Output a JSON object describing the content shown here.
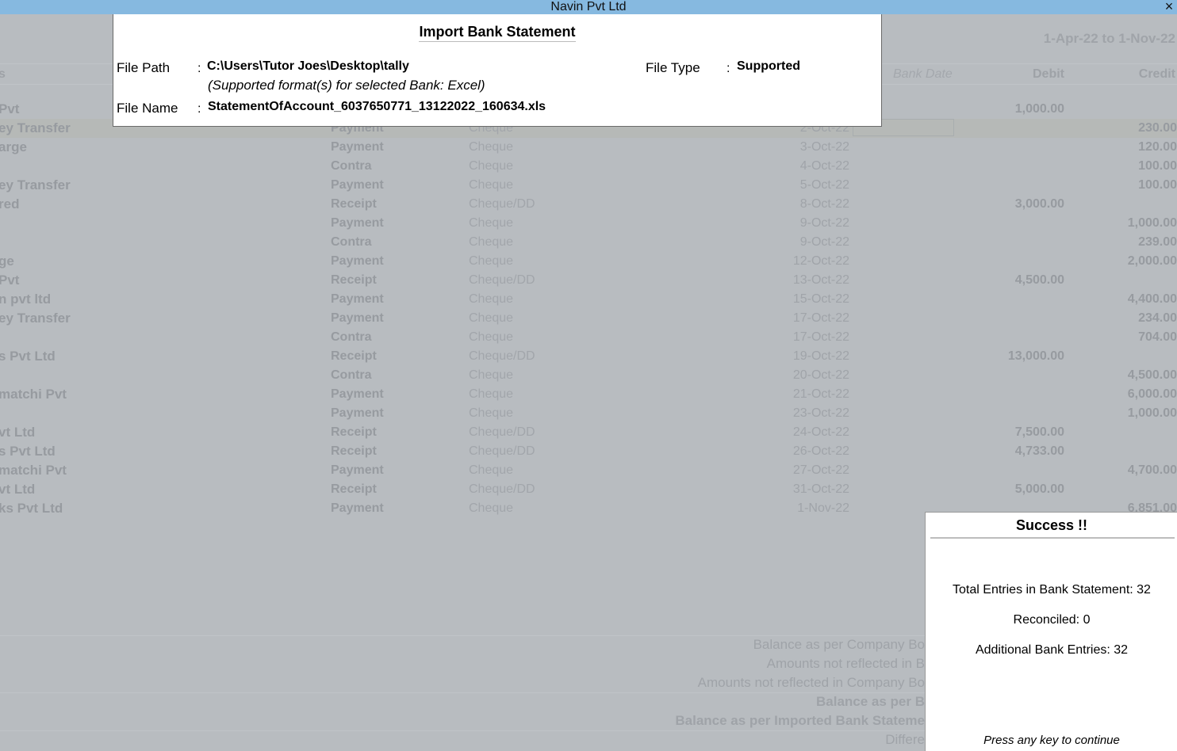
{
  "window": {
    "title": "Navin Pvt Ltd",
    "close_icon": "×"
  },
  "background": {
    "period": "1-Apr-22 to 1-Nov-22",
    "columns": {
      "particulars": "s",
      "bank_date": "Bank Date",
      "debit": "Debit",
      "credit": "Credit"
    },
    "rows": [
      {
        "particulars": "Pvt",
        "vch_type": "",
        "instrument": "",
        "date": "",
        "debit": "1,000.00",
        "credit": ""
      },
      {
        "particulars": "ey Transfer",
        "vch_type": "Payment",
        "instrument": "Cheque",
        "date": "2-Oct-22",
        "debit": "",
        "credit": "230.00"
      },
      {
        "particulars": "arge",
        "vch_type": "Payment",
        "instrument": "Cheque",
        "date": "3-Oct-22",
        "debit": "",
        "credit": "120.00"
      },
      {
        "particulars": "",
        "vch_type": "Contra",
        "instrument": "Cheque",
        "date": "4-Oct-22",
        "debit": "",
        "credit": "100.00"
      },
      {
        "particulars": "ey Transfer",
        "vch_type": "Payment",
        "instrument": "Cheque",
        "date": "5-Oct-22",
        "debit": "",
        "credit": "100.00"
      },
      {
        "particulars": "red",
        "vch_type": "Receipt",
        "instrument": "Cheque/DD",
        "date": "8-Oct-22",
        "debit": "3,000.00",
        "credit": ""
      },
      {
        "particulars": "",
        "vch_type": "Payment",
        "instrument": "Cheque",
        "date": "9-Oct-22",
        "debit": "",
        "credit": "1,000.00"
      },
      {
        "particulars": "",
        "vch_type": "Contra",
        "instrument": "Cheque",
        "date": "9-Oct-22",
        "debit": "",
        "credit": "239.00"
      },
      {
        "particulars": "ge",
        "vch_type": "Payment",
        "instrument": "Cheque",
        "date": "12-Oct-22",
        "debit": "",
        "credit": "2,000.00"
      },
      {
        "particulars": "Pvt",
        "vch_type": "Receipt",
        "instrument": "Cheque/DD",
        "date": "13-Oct-22",
        "debit": "4,500.00",
        "credit": ""
      },
      {
        "particulars": "n pvt ltd",
        "vch_type": "Payment",
        "instrument": "Cheque",
        "date": "15-Oct-22",
        "debit": "",
        "credit": "4,400.00"
      },
      {
        "particulars": "ey Transfer",
        "vch_type": "Payment",
        "instrument": "Cheque",
        "date": "17-Oct-22",
        "debit": "",
        "credit": "234.00"
      },
      {
        "particulars": "",
        "vch_type": "Contra",
        "instrument": "Cheque",
        "date": "17-Oct-22",
        "debit": "",
        "credit": "704.00"
      },
      {
        "particulars": "s Pvt Ltd",
        "vch_type": "Receipt",
        "instrument": "Cheque/DD",
        "date": "19-Oct-22",
        "debit": "13,000.00",
        "credit": ""
      },
      {
        "particulars": "",
        "vch_type": "Contra",
        "instrument": "Cheque",
        "date": "20-Oct-22",
        "debit": "",
        "credit": "4,500.00"
      },
      {
        "particulars": "matchi Pvt",
        "vch_type": "Payment",
        "instrument": "Cheque",
        "date": "21-Oct-22",
        "debit": "",
        "credit": "6,000.00"
      },
      {
        "particulars": "",
        "vch_type": "Payment",
        "instrument": "Cheque",
        "date": "23-Oct-22",
        "debit": "",
        "credit": "1,000.00"
      },
      {
        "particulars": "vt Ltd",
        "vch_type": "Receipt",
        "instrument": "Cheque/DD",
        "date": "24-Oct-22",
        "debit": "7,500.00",
        "credit": ""
      },
      {
        "particulars": "s Pvt Ltd",
        "vch_type": "Receipt",
        "instrument": "Cheque/DD",
        "date": "26-Oct-22",
        "debit": "4,733.00",
        "credit": ""
      },
      {
        "particulars": "matchi Pvt",
        "vch_type": "Payment",
        "instrument": "Cheque",
        "date": "27-Oct-22",
        "debit": "",
        "credit": "4,700.00"
      },
      {
        "particulars": "vt Ltd",
        "vch_type": "Receipt",
        "instrument": "Cheque/DD",
        "date": "31-Oct-22",
        "debit": "5,000.00",
        "credit": ""
      },
      {
        "particulars": "ks Pvt Ltd",
        "vch_type": "Payment",
        "instrument": "Cheque",
        "date": "1-Nov-22",
        "debit": "",
        "credit": "6,851.00"
      }
    ],
    "summary": [
      {
        "label": "Balance as per Company Bo",
        "bold": false
      },
      {
        "label": "Amounts not reflected in B",
        "bold": false
      },
      {
        "label": "Amounts not reflected in Company Bo",
        "bold": false
      },
      {
        "label": "Balance as per B",
        "bold": true
      },
      {
        "label": "Balance as per Imported Bank Stateme",
        "bold": true
      },
      {
        "label": "Differe",
        "bold": false
      }
    ]
  },
  "import_dialog": {
    "title": "Import Bank Statement",
    "file_path_label": "File Path",
    "file_path_value": "C:\\Users\\Tutor Joes\\Desktop\\tally",
    "supported_note": "(Supported format(s) for selected Bank: Excel)",
    "file_name_label": "File Name",
    "file_name_value": "StatementOfAccount_6037650771_13122022_160634.xls",
    "file_type_label": "File Type",
    "file_type_value": "Supported",
    "colon": ":"
  },
  "success_dialog": {
    "title": "Success !!",
    "total_entries": "Total Entries in Bank Statement: 32",
    "reconciled": "Reconciled: 0",
    "additional_entries": "Additional Bank Entries: 32",
    "footer": "Press any key to continue"
  }
}
